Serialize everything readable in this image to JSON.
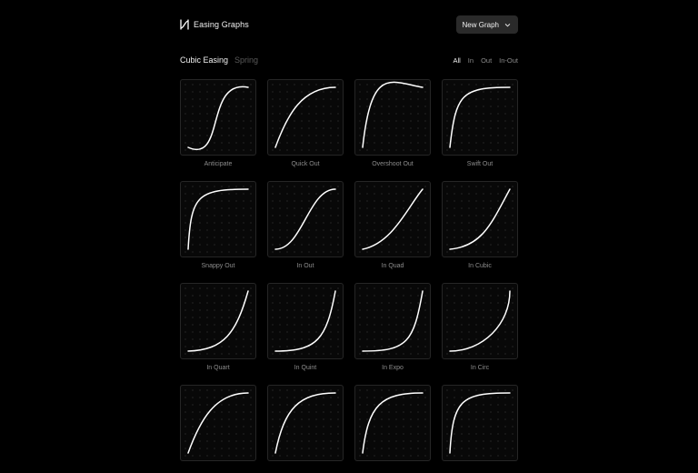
{
  "app": {
    "title": "Easing Graphs",
    "logo_icon": "bezier-logo-icon"
  },
  "header": {
    "new_button_label": "New Graph",
    "new_button_icon": "chevron-down-icon"
  },
  "tabs": [
    {
      "label": "Cubic Easing",
      "active": true
    },
    {
      "label": "Spring",
      "active": false
    }
  ],
  "filters": [
    {
      "label": "All",
      "active": true
    },
    {
      "label": "In",
      "active": false
    },
    {
      "label": "Out",
      "active": false
    },
    {
      "label": "In-Out",
      "active": false
    }
  ],
  "colors": {
    "background": "#000000",
    "curve": "#ffffff",
    "card_border": "#262626",
    "button_bg": "#2a2a2a"
  },
  "graphs": [
    {
      "name": "Anticipate",
      "bezier": [
        0.62,
        -0.28,
        0.28,
        1.14
      ]
    },
    {
      "name": "Quick Out",
      "bezier": [
        0.2,
        0.55,
        0.45,
        1
      ]
    },
    {
      "name": "Overshoot Out",
      "bezier": [
        0.15,
        1.35,
        0.45,
        1.1
      ]
    },
    {
      "name": "Swift Out",
      "bezier": [
        0.1,
        0.9,
        0.2,
        1
      ]
    },
    {
      "name": "Snappy Out",
      "bezier": [
        0.05,
        0.9,
        0.15,
        1
      ]
    },
    {
      "name": "In Out",
      "bezier": [
        0.45,
        0,
        0.55,
        1
      ]
    },
    {
      "name": "In Quad",
      "bezier": [
        0.5,
        0.1,
        0.75,
        0.7
      ]
    },
    {
      "name": "In Cubic",
      "bezier": [
        0.55,
        0.05,
        0.7,
        0.45
      ]
    },
    {
      "name": "In Quart",
      "bezier": [
        0.6,
        0.02,
        0.8,
        0.3
      ]
    },
    {
      "name": "In Quint",
      "bezier": [
        0.7,
        0,
        0.85,
        0.2
      ]
    },
    {
      "name": "In Expo",
      "bezier": [
        0.75,
        0,
        0.85,
        0.15
      ]
    },
    {
      "name": "In Circ",
      "bezier": [
        0.55,
        0,
        1,
        0.45
      ]
    },
    {
      "name": "",
      "bezier": [
        0.2,
        0.55,
        0.45,
        1
      ]
    },
    {
      "name": "",
      "bezier": [
        0.15,
        0.75,
        0.4,
        1
      ]
    },
    {
      "name": "",
      "bezier": [
        0.1,
        0.8,
        0.3,
        1
      ]
    },
    {
      "name": "",
      "bezier": [
        0.05,
        0.9,
        0.2,
        1
      ]
    }
  ]
}
